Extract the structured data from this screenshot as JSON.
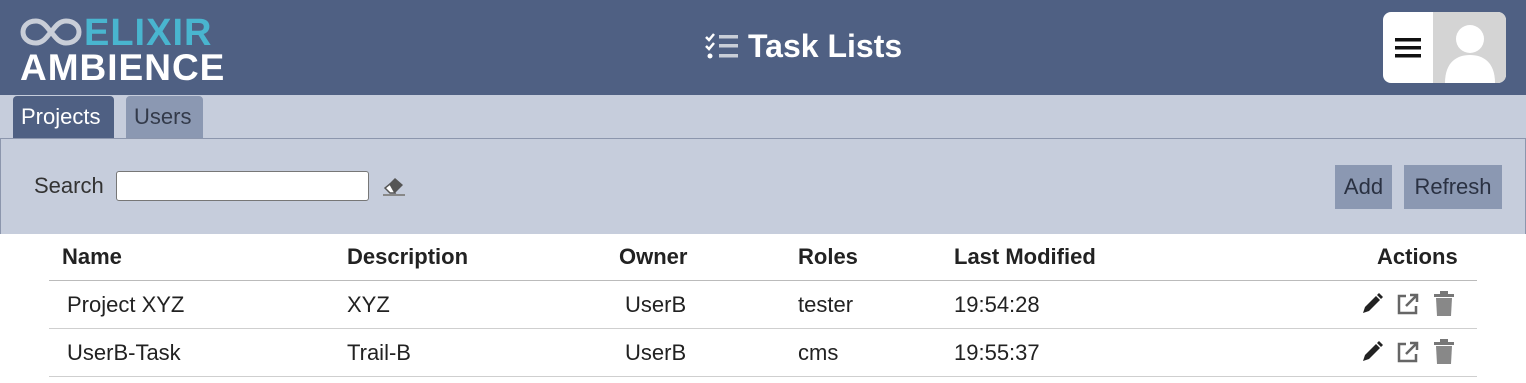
{
  "brand": {
    "line1": "ELIXIR",
    "line2": "AMBIENCE"
  },
  "header": {
    "title": "Task Lists",
    "title_icon": "checklist-icon",
    "menu_icon": "hamburger-menu-icon",
    "avatar_icon": "user-avatar-icon"
  },
  "tabs": [
    {
      "label": "Projects",
      "active": true
    },
    {
      "label": "Users",
      "active": false
    }
  ],
  "toolbar": {
    "search_label": "Search",
    "search_value": "",
    "clear_icon": "eraser-icon",
    "add_label": "Add",
    "refresh_label": "Refresh"
  },
  "table": {
    "columns": [
      "Name",
      "Description",
      "Owner",
      "Roles",
      "Last Modified",
      "Actions"
    ],
    "rows": [
      {
        "name": "Project XYZ",
        "description": "XYZ",
        "owner": "UserB",
        "roles": "tester",
        "last_modified": "19:54:28"
      },
      {
        "name": "UserB-Task",
        "description": "Trail-B",
        "owner": "UserB",
        "roles": "cms",
        "last_modified": "19:55:37"
      }
    ],
    "row_action_icons": [
      "pencil-icon",
      "external-link-icon",
      "trash-icon"
    ]
  },
  "colors": {
    "header": "#4f6083",
    "accent": "#49b5cf",
    "panel": "#c6cddc",
    "button": "#8b98b2"
  }
}
